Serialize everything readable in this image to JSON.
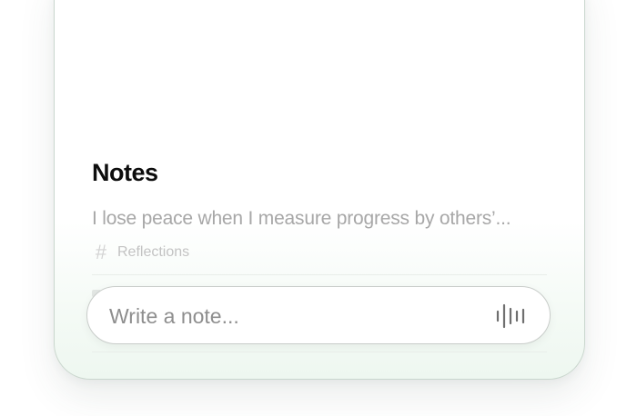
{
  "notes": {
    "title": "Notes",
    "items": [
      {
        "preview": "I lose peace when I measure progress by others’...",
        "tag": "Reflections"
      }
    ]
  },
  "composer": {
    "placeholder": "Write a note..."
  },
  "icons": {
    "tag": "hash-icon",
    "voice": "waveform-icon"
  },
  "colors": {
    "title": "#0d0d0d",
    "preview_text": "#a7a7a7",
    "tag_text": "#c3c3c3",
    "card_tint": "#eef7f0"
  }
}
